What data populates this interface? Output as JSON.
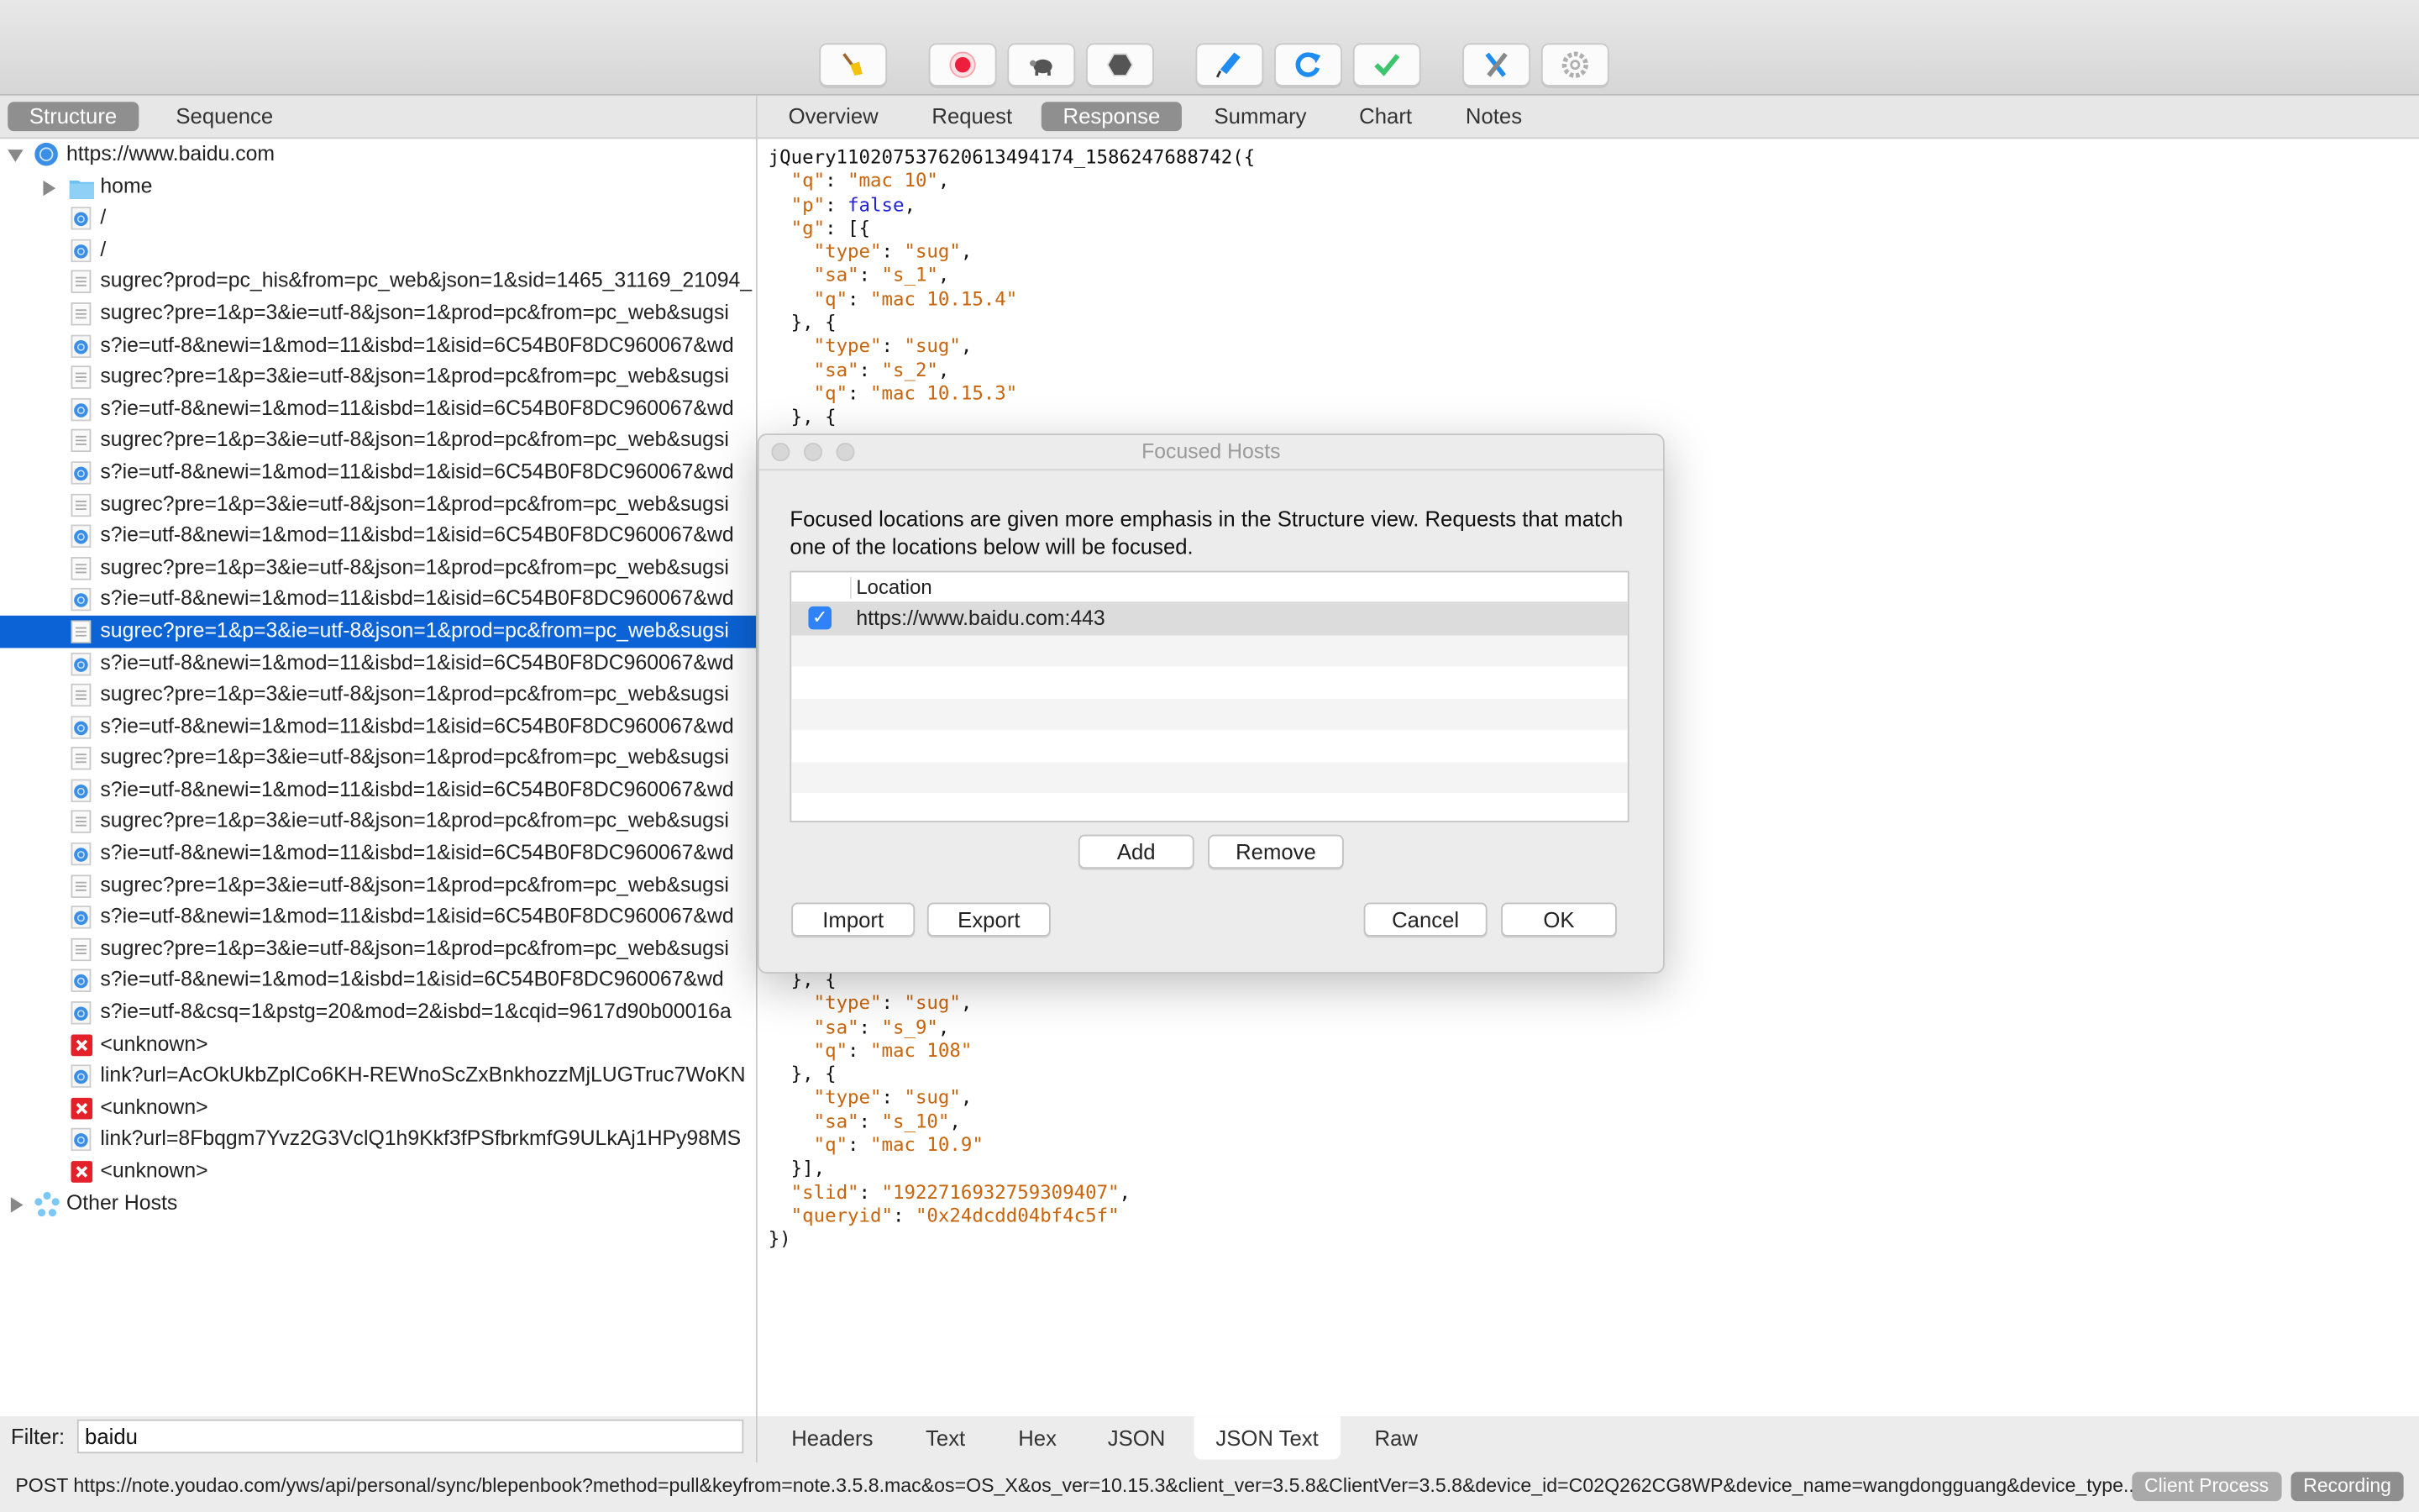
{
  "toolbar": {
    "buttons": [
      {
        "name": "clear-session",
        "icon": "broom-icon"
      },
      {
        "name": "record",
        "icon": "record-icon"
      },
      {
        "name": "throttle",
        "icon": "turtle-icon"
      },
      {
        "name": "breakpoints",
        "icon": "hexagon-stop-icon"
      },
      {
        "name": "edit",
        "icon": "pen-icon"
      },
      {
        "name": "repeat",
        "icon": "refresh-icon"
      },
      {
        "name": "validate",
        "icon": "checkmark-icon"
      },
      {
        "name": "tools",
        "icon": "tools-icon"
      },
      {
        "name": "settings",
        "icon": "gear-icon"
      }
    ]
  },
  "left_tabs": [
    {
      "label": "Structure",
      "active": true
    },
    {
      "label": "Sequence",
      "active": false
    }
  ],
  "tree": {
    "host": "https://www.baidu.com",
    "rows": [
      {
        "label": "home",
        "type": "folder",
        "expandable": true
      },
      {
        "label": "/",
        "type": "web"
      },
      {
        "label": "/",
        "type": "web"
      },
      {
        "label": "sugrec?prod=pc_his&from=pc_web&json=1&sid=1465_31169_21094_",
        "type": "doc"
      },
      {
        "label": "sugrec?pre=1&p=3&ie=utf-8&json=1&prod=pc&from=pc_web&sugsi",
        "type": "doc"
      },
      {
        "label": "s?ie=utf-8&newi=1&mod=11&isbd=1&isid=6C54B0F8DC960067&wd",
        "type": "web"
      },
      {
        "label": "sugrec?pre=1&p=3&ie=utf-8&json=1&prod=pc&from=pc_web&sugsi",
        "type": "doc"
      },
      {
        "label": "s?ie=utf-8&newi=1&mod=11&isbd=1&isid=6C54B0F8DC960067&wd",
        "type": "web"
      },
      {
        "label": "sugrec?pre=1&p=3&ie=utf-8&json=1&prod=pc&from=pc_web&sugsi",
        "type": "doc"
      },
      {
        "label": "s?ie=utf-8&newi=1&mod=11&isbd=1&isid=6C54B0F8DC960067&wd",
        "type": "web"
      },
      {
        "label": "sugrec?pre=1&p=3&ie=utf-8&json=1&prod=pc&from=pc_web&sugsi",
        "type": "doc"
      },
      {
        "label": "s?ie=utf-8&newi=1&mod=11&isbd=1&isid=6C54B0F8DC960067&wd",
        "type": "web"
      },
      {
        "label": "sugrec?pre=1&p=3&ie=utf-8&json=1&prod=pc&from=pc_web&sugsi",
        "type": "doc"
      },
      {
        "label": "s?ie=utf-8&newi=1&mod=11&isbd=1&isid=6C54B0F8DC960067&wd",
        "type": "web"
      },
      {
        "label": "sugrec?pre=1&p=3&ie=utf-8&json=1&prod=pc&from=pc_web&sugsi",
        "type": "doc",
        "selected": true
      },
      {
        "label": "s?ie=utf-8&newi=1&mod=11&isbd=1&isid=6C54B0F8DC960067&wd",
        "type": "web"
      },
      {
        "label": "sugrec?pre=1&p=3&ie=utf-8&json=1&prod=pc&from=pc_web&sugsi",
        "type": "doc"
      },
      {
        "label": "s?ie=utf-8&newi=1&mod=11&isbd=1&isid=6C54B0F8DC960067&wd",
        "type": "web"
      },
      {
        "label": "sugrec?pre=1&p=3&ie=utf-8&json=1&prod=pc&from=pc_web&sugsi",
        "type": "doc"
      },
      {
        "label": "s?ie=utf-8&newi=1&mod=11&isbd=1&isid=6C54B0F8DC960067&wd",
        "type": "web"
      },
      {
        "label": "sugrec?pre=1&p=3&ie=utf-8&json=1&prod=pc&from=pc_web&sugsi",
        "type": "doc"
      },
      {
        "label": "s?ie=utf-8&newi=1&mod=11&isbd=1&isid=6C54B0F8DC960067&wd",
        "type": "web"
      },
      {
        "label": "sugrec?pre=1&p=3&ie=utf-8&json=1&prod=pc&from=pc_web&sugsi",
        "type": "doc"
      },
      {
        "label": "s?ie=utf-8&newi=1&mod=11&isbd=1&isid=6C54B0F8DC960067&wd",
        "type": "web"
      },
      {
        "label": "sugrec?pre=1&p=3&ie=utf-8&json=1&prod=pc&from=pc_web&sugsi",
        "type": "doc"
      },
      {
        "label": "s?ie=utf-8&newi=1&mod=1&isbd=1&isid=6C54B0F8DC960067&wd",
        "type": "web"
      },
      {
        "label": "s?ie=utf-8&csq=1&pstg=20&mod=2&isbd=1&cqid=9617d90b00016a",
        "type": "web"
      },
      {
        "label": "<unknown>",
        "type": "error"
      },
      {
        "label": "link?url=AcOkUkbZplCo6KH-REWnoScZxBnkhozzMjLUGTruc7WoKN",
        "type": "web"
      },
      {
        "label": "<unknown>",
        "type": "error"
      },
      {
        "label": "link?url=8Fbqgm7Yvz2G3VclQ1h9Kkf3fPSfbrkmfG9ULkAj1HPy98MS",
        "type": "web"
      },
      {
        "label": "<unknown>",
        "type": "error"
      }
    ],
    "other_hosts": "Other Hosts"
  },
  "filter": {
    "label": "Filter:",
    "value": "baidu"
  },
  "right_tabs": [
    {
      "label": "Overview",
      "active": false
    },
    {
      "label": "Request",
      "active": false
    },
    {
      "label": "Response",
      "active": true
    },
    {
      "label": "Summary",
      "active": false
    },
    {
      "label": "Chart",
      "active": false
    },
    {
      "label": "Notes",
      "active": false
    }
  ],
  "response_lines_top": [
    [
      {
        "t": "jQuery110207537620613494174_1586247688742({",
        "c": ""
      }
    ],
    [
      {
        "t": "  ",
        "c": ""
      },
      {
        "t": "\"q\"",
        "c": "str"
      },
      {
        "t": ": ",
        "c": ""
      },
      {
        "t": "\"mac 10\"",
        "c": "str"
      },
      {
        "t": ",",
        "c": ""
      }
    ],
    [
      {
        "t": "  ",
        "c": ""
      },
      {
        "t": "\"p\"",
        "c": "str"
      },
      {
        "t": ": ",
        "c": ""
      },
      {
        "t": "false",
        "c": "kw"
      },
      {
        "t": ",",
        "c": ""
      }
    ],
    [
      {
        "t": "  ",
        "c": ""
      },
      {
        "t": "\"g\"",
        "c": "str"
      },
      {
        "t": ": [{",
        "c": ""
      }
    ],
    [
      {
        "t": "    ",
        "c": ""
      },
      {
        "t": "\"type\"",
        "c": "str"
      },
      {
        "t": ": ",
        "c": ""
      },
      {
        "t": "\"sug\"",
        "c": "str"
      },
      {
        "t": ",",
        "c": ""
      }
    ],
    [
      {
        "t": "    ",
        "c": ""
      },
      {
        "t": "\"sa\"",
        "c": "str"
      },
      {
        "t": ": ",
        "c": ""
      },
      {
        "t": "\"s_1\"",
        "c": "str"
      },
      {
        "t": ",",
        "c": ""
      }
    ],
    [
      {
        "t": "    ",
        "c": ""
      },
      {
        "t": "\"q\"",
        "c": "str"
      },
      {
        "t": ": ",
        "c": ""
      },
      {
        "t": "\"mac 10.15.4\"",
        "c": "str"
      }
    ],
    [
      {
        "t": "  }, {",
        "c": ""
      }
    ],
    [
      {
        "t": "    ",
        "c": ""
      },
      {
        "t": "\"type\"",
        "c": "str"
      },
      {
        "t": ": ",
        "c": ""
      },
      {
        "t": "\"sug\"",
        "c": "str"
      },
      {
        "t": ",",
        "c": ""
      }
    ],
    [
      {
        "t": "    ",
        "c": ""
      },
      {
        "t": "\"sa\"",
        "c": "str"
      },
      {
        "t": ": ",
        "c": ""
      },
      {
        "t": "\"s_2\"",
        "c": "str"
      },
      {
        "t": ",",
        "c": ""
      }
    ],
    [
      {
        "t": "    ",
        "c": ""
      },
      {
        "t": "\"q\"",
        "c": "str"
      },
      {
        "t": ": ",
        "c": ""
      },
      {
        "t": "\"mac 10.15.3\"",
        "c": "str"
      }
    ],
    [
      {
        "t": "  }, {",
        "c": ""
      }
    ]
  ],
  "response_lines_bottom": [
    [
      {
        "t": "  }, {",
        "c": ""
      }
    ],
    [
      {
        "t": "    ",
        "c": ""
      },
      {
        "t": "\"type\"",
        "c": "str"
      },
      {
        "t": ": ",
        "c": ""
      },
      {
        "t": "\"sug\"",
        "c": "str"
      },
      {
        "t": ",",
        "c": ""
      }
    ],
    [
      {
        "t": "    ",
        "c": ""
      },
      {
        "t": "\"sa\"",
        "c": "str"
      },
      {
        "t": ": ",
        "c": ""
      },
      {
        "t": "\"s_9\"",
        "c": "str"
      },
      {
        "t": ",",
        "c": ""
      }
    ],
    [
      {
        "t": "    ",
        "c": ""
      },
      {
        "t": "\"q\"",
        "c": "str"
      },
      {
        "t": ": ",
        "c": ""
      },
      {
        "t": "\"mac 108\"",
        "c": "str"
      }
    ],
    [
      {
        "t": "  }, {",
        "c": ""
      }
    ],
    [
      {
        "t": "    ",
        "c": ""
      },
      {
        "t": "\"type\"",
        "c": "str"
      },
      {
        "t": ": ",
        "c": ""
      },
      {
        "t": "\"sug\"",
        "c": "str"
      },
      {
        "t": ",",
        "c": ""
      }
    ],
    [
      {
        "t": "    ",
        "c": ""
      },
      {
        "t": "\"sa\"",
        "c": "str"
      },
      {
        "t": ": ",
        "c": ""
      },
      {
        "t": "\"s_10\"",
        "c": "str"
      },
      {
        "t": ",",
        "c": ""
      }
    ],
    [
      {
        "t": "    ",
        "c": ""
      },
      {
        "t": "\"q\"",
        "c": "str"
      },
      {
        "t": ": ",
        "c": ""
      },
      {
        "t": "\"mac 10.9\"",
        "c": "str"
      }
    ],
    [
      {
        "t": "  }],",
        "c": ""
      }
    ],
    [
      {
        "t": "  ",
        "c": ""
      },
      {
        "t": "\"slid\"",
        "c": "str"
      },
      {
        "t": ": ",
        "c": ""
      },
      {
        "t": "\"1922716932759309407\"",
        "c": "str"
      },
      {
        "t": ",",
        "c": ""
      }
    ],
    [
      {
        "t": "  ",
        "c": ""
      },
      {
        "t": "\"queryid\"",
        "c": "str"
      },
      {
        "t": ": ",
        "c": ""
      },
      {
        "t": "\"0x24dcdd04bf4c5f\"",
        "c": "str"
      }
    ],
    [
      {
        "t": "})",
        "c": ""
      }
    ]
  ],
  "bottom_tabs": [
    {
      "label": "Headers",
      "active": false
    },
    {
      "label": "Text",
      "active": false
    },
    {
      "label": "Hex",
      "active": false
    },
    {
      "label": "JSON",
      "active": false
    },
    {
      "label": "JSON Text",
      "active": true
    },
    {
      "label": "Raw",
      "active": false
    }
  ],
  "status": {
    "text": "POST https://note.youdao.com/yws/api/personal/sync/blepenbook?method=pull&keyfrom=note.3.5.8.mac&os=OS_X&os_ver=10.15.3&client_ver=3.5.8&ClientVer=3.5.8&device_id=C02Q262CG8WP&device_name=wangdongguang&device_type...",
    "client_process": "Client Process",
    "recording": "Recording"
  },
  "dialog": {
    "title": "Focused Hosts",
    "description": "Focused locations are given more emphasis in the Structure view.  Requests that match one of the locations below will be focused.",
    "column_header": "Location",
    "locations": [
      {
        "location": "https://www.baidu.com:443",
        "enabled": true
      }
    ],
    "add_label": "Add",
    "remove_label": "Remove",
    "import_label": "Import",
    "export_label": "Export",
    "cancel_label": "Cancel",
    "ok_label": "OK"
  },
  "colors": {
    "selection": "#0b63d6",
    "json_string": "#c8650d",
    "json_keyword": "#2222d8",
    "checkbox": "#2f82f7"
  }
}
